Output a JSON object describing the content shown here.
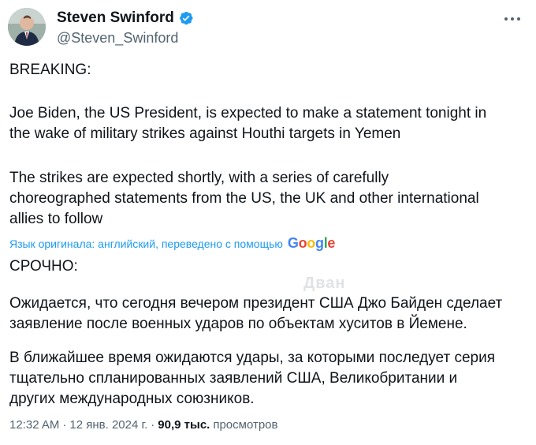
{
  "author": {
    "name": "Steven Swinford",
    "handle": "@Steven_Swinford",
    "verified": true
  },
  "icons": {
    "verified": "verified-badge-icon",
    "more": "more-horizontal-icon"
  },
  "tweet": {
    "original": {
      "heading": "BREAKING:",
      "p1_line1": "Joe Biden, the US President, is expected to make a statement tonight in",
      "p1_line2": "the wake of military strikes against Houthi targets in Yemen",
      "p2_line1": "The strikes are expected shortly, with a series of carefully",
      "p2_line2": "choreographed statements from the US, the UK and other international",
      "p2_line3": "allies to follow"
    },
    "translation_note": "Язык оригинала: английский, переведено с помощью",
    "translation_provider": [
      "G",
      "o",
      "o",
      "g",
      "l",
      "e"
    ],
    "translated": {
      "heading": "СРОЧНО:",
      "p1_line1": "Ожидается, что сегодня вечером президент США Джо Байден сделает",
      "p1_line2": "заявление после военных ударов по объектам хуситов в Йемене.",
      "p2_line1": "В ближайшее время ожидаются удары, за которыми последует серия",
      "p2_line2": "тщательно спланированных заявлений США, Великобритании и",
      "p2_line3": "других международных союзников."
    },
    "watermark": "Дван"
  },
  "meta": {
    "time": "12:32 AM",
    "separator": "·",
    "date": "12 янв. 2024 г.",
    "views_count": "90,9 тыс.",
    "views_label": "просмотров"
  },
  "colors": {
    "text": "#0f1419",
    "secondary": "#536471",
    "link": "#1d9bf0",
    "verified": "#1d9bf0"
  }
}
